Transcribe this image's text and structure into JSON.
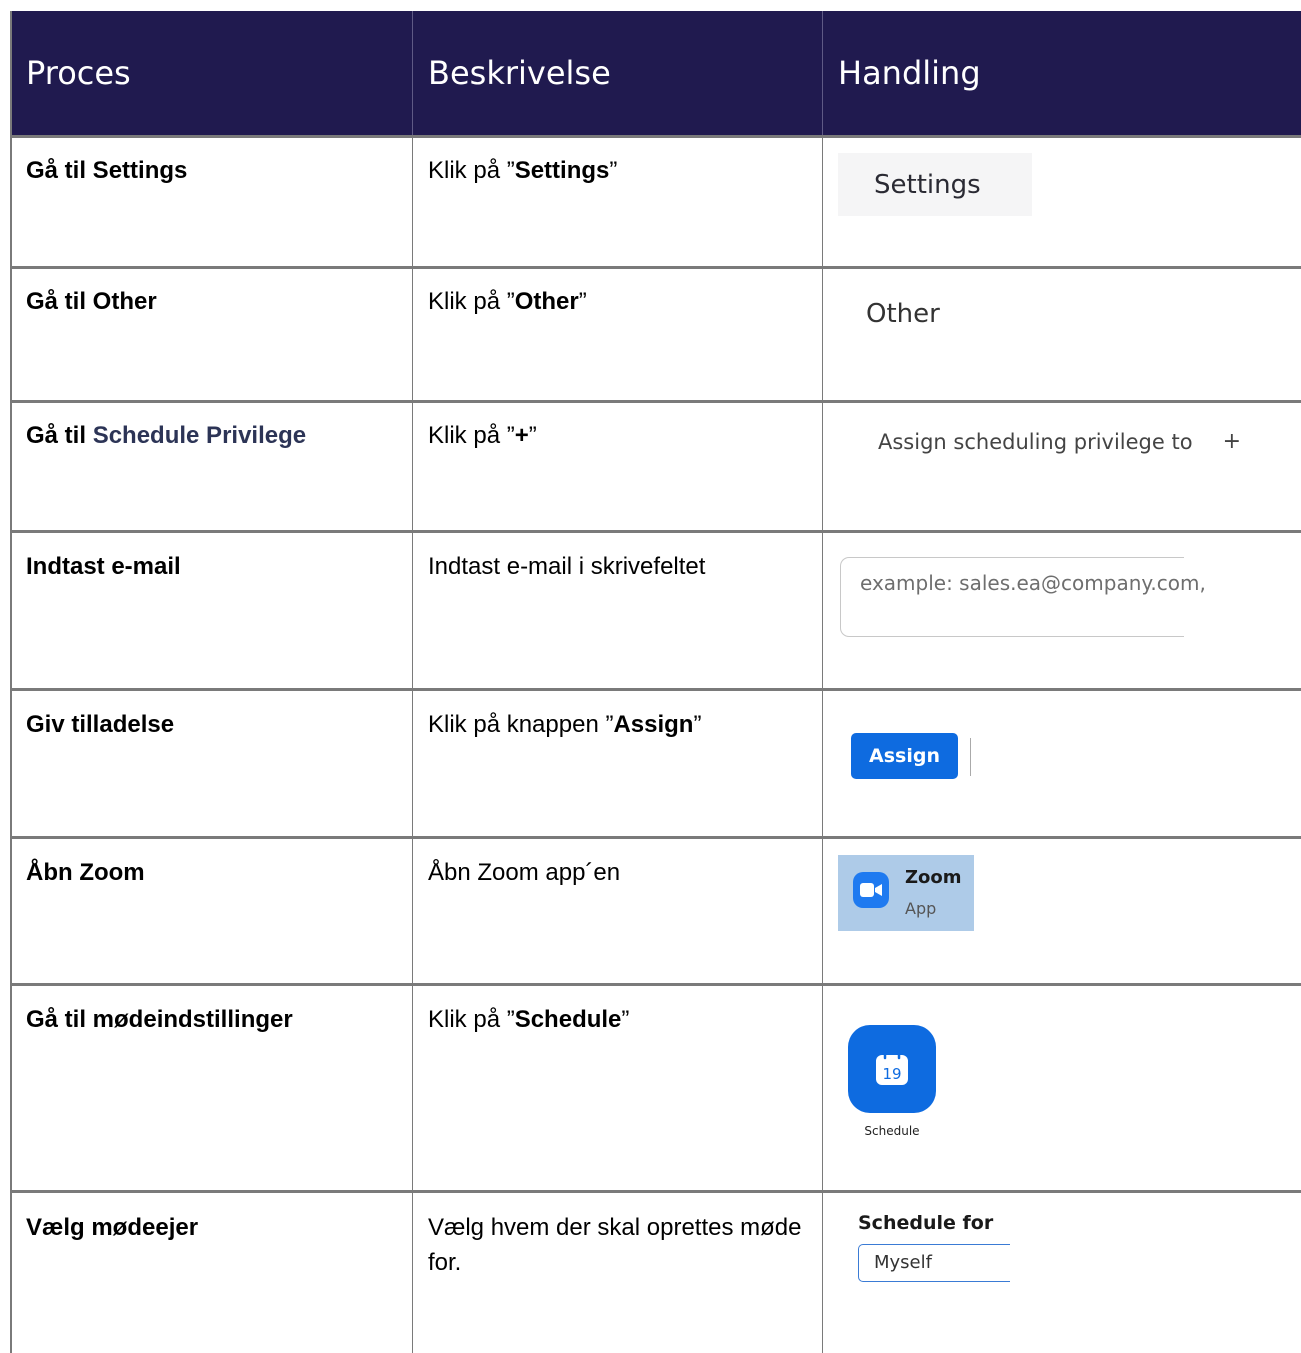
{
  "header": {
    "col_process": "Proces",
    "col_description": "Beskrivelse",
    "col_action": "Handling"
  },
  "rows": [
    {
      "process": "Gå til Settings",
      "desc_pre": "Klik på ”",
      "desc_bold": "Settings",
      "desc_post": "”"
    },
    {
      "process": "Gå til Other",
      "desc_pre": "Klik på ”",
      "desc_bold": "Other",
      "desc_post": "”"
    },
    {
      "process_pre": "Gå til ",
      "process_link": "Schedule Privilege",
      "desc_pre": "Klik på ”",
      "desc_bold": "+",
      "desc_post": "”"
    },
    {
      "process": "Indtast e-mail",
      "desc": "Indtast e-mail i skrivefeltet"
    },
    {
      "process": "Giv tilladelse",
      "desc_pre": "Klik på knappen ”",
      "desc_bold": "Assign",
      "desc_post": "”"
    },
    {
      "process": "Åbn Zoom",
      "desc": "Åbn Zoom app´en"
    },
    {
      "process": "Gå til mødeindstillinger",
      "desc_pre": "Klik på ”",
      "desc_bold": "Schedule",
      "desc_post": "”"
    },
    {
      "process": "Vælg mødeejer",
      "desc": "Vælg hvem der skal oprettes møde for."
    }
  ],
  "actions": {
    "settings_label": "Settings",
    "other_label": "Other",
    "assign_privilege_label": "Assign scheduling privilege to",
    "plus_label": "+",
    "email_placeholder": "example: sales.ea@company.com,",
    "assign_button": "Assign",
    "zoom_name": "Zoom",
    "zoom_sub": "App",
    "schedule_day": "19",
    "schedule_label": "Schedule",
    "schedule_for_label": "Schedule for",
    "schedule_for_value": "Myself"
  },
  "colors": {
    "header_bg": "#201a4f",
    "zoom_blue": "#0e6be0",
    "zoom_tile": "#aecbe8"
  }
}
